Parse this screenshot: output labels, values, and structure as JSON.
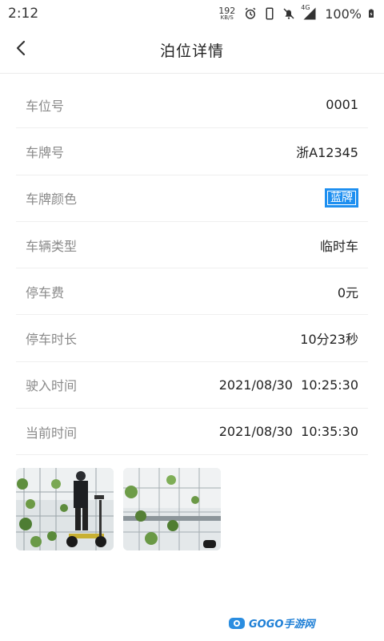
{
  "status_bar": {
    "time": "2:12",
    "net_speed_value": "192",
    "net_speed_unit": "KB/S",
    "network": "4G",
    "battery": "100%"
  },
  "header": {
    "title": "泊位详情"
  },
  "details": [
    {
      "label": "车位号",
      "value": "0001"
    },
    {
      "label": "车牌号",
      "value": "浙A12345"
    },
    {
      "label": "车牌颜色",
      "value": "蓝牌",
      "badge_color": "#1e8ff0"
    },
    {
      "label": "车辆类型",
      "value": "临时车"
    },
    {
      "label": "停车费",
      "value": "0元"
    },
    {
      "label": "停车时长",
      "value": "10分23秒"
    },
    {
      "label": "驶入时间",
      "value": "2021/08/30  10:25:30"
    },
    {
      "label": "当前时间",
      "value": "2021/08/30  10:35:30"
    }
  ],
  "watermark": {
    "text": "GOGO手游网"
  }
}
